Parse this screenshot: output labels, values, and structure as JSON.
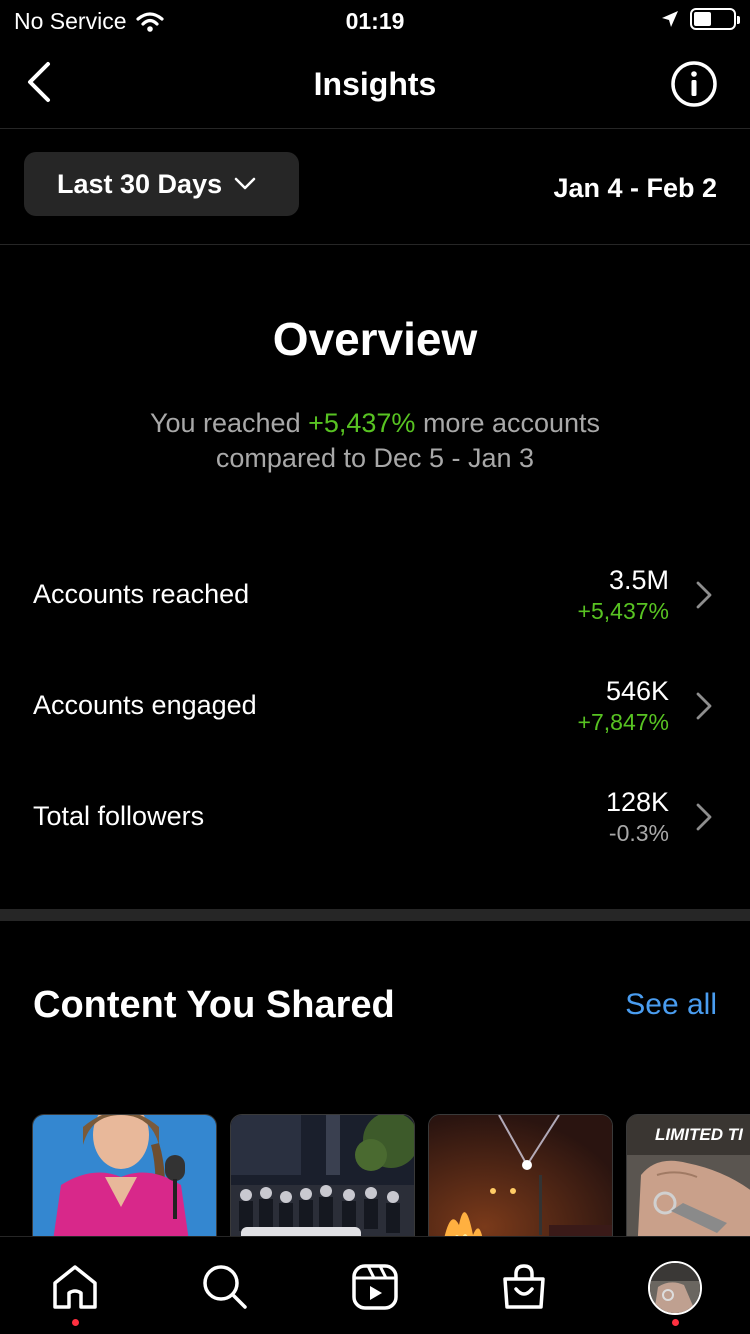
{
  "status_bar": {
    "carrier": "No Service",
    "time": "01:19",
    "battery_level": 0.45
  },
  "header": {
    "title": "Insights"
  },
  "filter": {
    "range_label": "Last 30 Days",
    "date_range": "Jan 4 - Feb 2"
  },
  "overview": {
    "title": "Overview",
    "summary_prefix": "You reached ",
    "summary_highlight": "+5,437%",
    "summary_suffix": " more accounts",
    "summary_line2": "compared to Dec 5 - Jan 3"
  },
  "metrics": [
    {
      "label": "Accounts reached",
      "value": "3.5M",
      "change": "+5,437%",
      "change_color": "#58c322"
    },
    {
      "label": "Accounts engaged",
      "value": "546K",
      "change": "+7,847%",
      "change_color": "#58c322"
    },
    {
      "label": "Total followers",
      "value": "128K",
      "change": "-0.3%",
      "change_color": "#a8a8a8"
    }
  ],
  "content_section": {
    "title": "Content You Shared",
    "see_all": "See all",
    "thumbnails": [
      {
        "name": "thumbnail-person-pink-shirt"
      },
      {
        "name": "thumbnail-night-crowd"
      },
      {
        "name": "thumbnail-night-fire"
      },
      {
        "name": "thumbnail-hand-keychain",
        "overlay_text": "LIMITED TI"
      }
    ]
  },
  "tab_bar": {
    "items": [
      "home-icon",
      "search-icon",
      "reels-icon",
      "shop-icon",
      "profile-avatar"
    ]
  },
  "colors": {
    "background": "#000000",
    "positive": "#58c322",
    "link": "#4a9df0",
    "muted": "#a8a8a8",
    "notification_dot": "#ff3040"
  }
}
